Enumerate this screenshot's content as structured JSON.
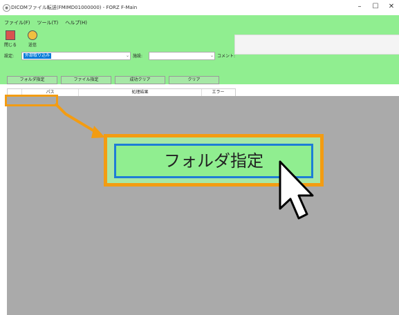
{
  "window": {
    "title": "DICOMファイル転送(FMIMD01000000) - FORZ F-Main",
    "minimize_glyph": "–",
    "maximize_glyph": "☐",
    "close_glyph": "✕"
  },
  "menu": [
    "ファイル(F)",
    "ツール(T)",
    "ヘルプ(H)"
  ],
  "toolbar": {
    "close_label": "閉じる",
    "send_label": "送信"
  },
  "form": {
    "settings_label": "設定:",
    "settings_value": "外部取り込み",
    "facility_label": "施設:",
    "facility_value": "",
    "comment_label": "コメント:"
  },
  "buttons": {
    "folder_select": "フォルダ指定",
    "file_select": "ファイル指定",
    "success_clear": "成功クリア",
    "clear": "クリア"
  },
  "grid": {
    "columns": [
      "",
      "パス",
      "処理結果",
      "エラー"
    ]
  },
  "callout": {
    "label": "フォルダ指定"
  },
  "colors": {
    "accent_green": "#90ee90",
    "highlight_orange": "#f39c12",
    "focus_blue": "#1e7dd6",
    "grid_grey": "#aaaaaa"
  }
}
